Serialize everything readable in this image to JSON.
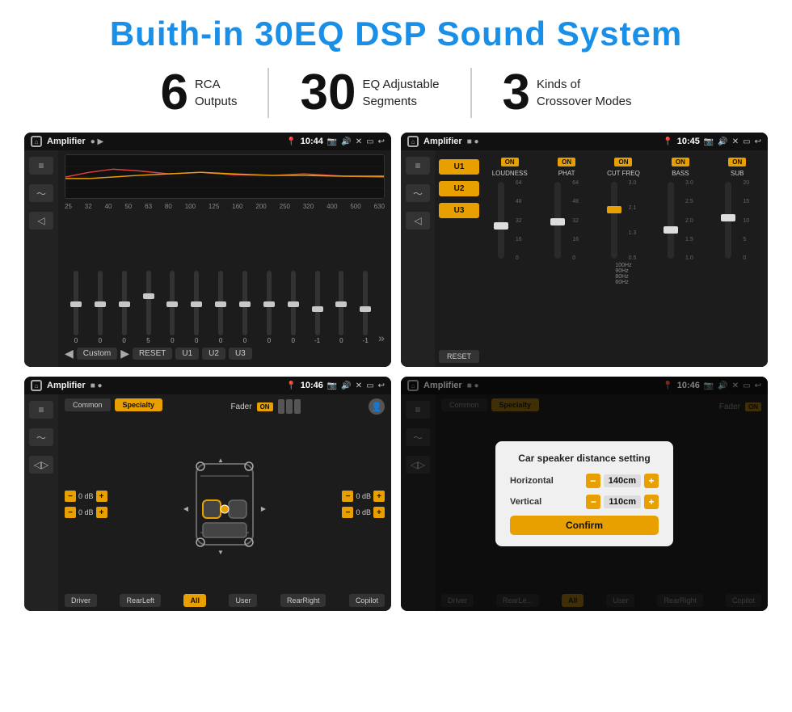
{
  "page": {
    "title": "Buith-in 30EQ DSP Sound System",
    "stats": [
      {
        "number": "6",
        "desc_line1": "RCA",
        "desc_line2": "Outputs"
      },
      {
        "number": "30",
        "desc_line1": "EQ Adjustable",
        "desc_line2": "Segments"
      },
      {
        "number": "3",
        "desc_line1": "Kinds of",
        "desc_line2": "Crossover Modes"
      }
    ],
    "screens": [
      {
        "id": "eq-screen",
        "status_bar": {
          "title": "Amplifier",
          "dots": "● ▶",
          "time": "10:44"
        },
        "type": "eq"
      },
      {
        "id": "crossover-screen",
        "status_bar": {
          "title": "Amplifier",
          "dots": "■ ●",
          "time": "10:45"
        },
        "type": "crossover"
      },
      {
        "id": "speaker-screen",
        "status_bar": {
          "title": "Amplifier",
          "dots": "■ ●",
          "time": "10:46"
        },
        "type": "speaker"
      },
      {
        "id": "distance-screen",
        "status_bar": {
          "title": "Amplifier",
          "dots": "■ ●",
          "time": "10:46"
        },
        "type": "distance_dialog"
      }
    ],
    "eq_labels": [
      "25",
      "32",
      "40",
      "50",
      "63",
      "80",
      "100",
      "125",
      "160",
      "200",
      "250",
      "320",
      "400",
      "500",
      "630"
    ],
    "eq_values": [
      "0",
      "0",
      "0",
      "5",
      "0",
      "0",
      "0",
      "0",
      "0",
      "0",
      "-1",
      "0",
      "-1"
    ],
    "eq_presets": [
      "◀",
      "Custom",
      "▶",
      "RESET",
      "U1",
      "U2",
      "U3"
    ],
    "crossover": {
      "u_buttons": [
        "U1",
        "U2",
        "U3"
      ],
      "controls": [
        {
          "label": "LOUDNESS",
          "on": true
        },
        {
          "label": "PHAT",
          "on": true
        },
        {
          "label": "CUT FREQ",
          "on": true
        },
        {
          "label": "BASS",
          "on": true
        },
        {
          "label": "SUB",
          "on": true
        }
      ],
      "reset": "RESET"
    },
    "speaker": {
      "tabs": [
        "Common",
        "Specialty"
      ],
      "active_tab": "Specialty",
      "fader_label": "Fader",
      "fader_on": "ON",
      "vol_labels": [
        "0 dB",
        "0 dB",
        "0 dB",
        "0 dB"
      ],
      "footer_btns": [
        "Driver",
        "RearLeft",
        "All",
        "User",
        "RearRight",
        "Copilot"
      ]
    },
    "dialog": {
      "title": "Car speaker distance setting",
      "horizontal_label": "Horizontal",
      "horizontal_value": "140cm",
      "vertical_label": "Vertical",
      "vertical_value": "110cm",
      "confirm_label": "Confirm"
    }
  }
}
